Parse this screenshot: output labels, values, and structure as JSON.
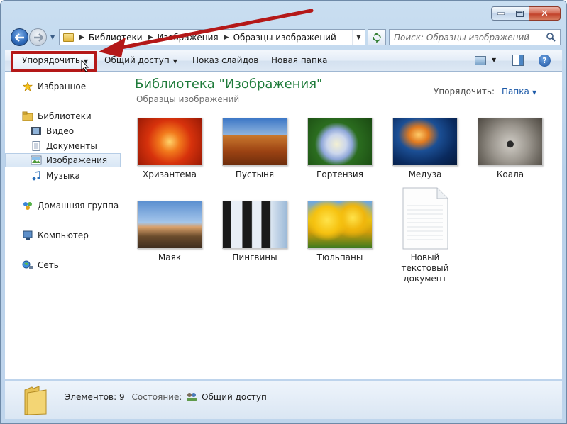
{
  "address": {
    "crumbs": [
      "Библиотеки",
      "Изображения",
      "Образцы изображений"
    ]
  },
  "search": {
    "placeholder": "Поиск: Образцы изображений"
  },
  "toolbar": {
    "organize": "Упорядочить",
    "share": "Общий доступ",
    "slideshow": "Показ слайдов",
    "new_folder": "Новая папка"
  },
  "sidebar": {
    "items": [
      {
        "label": "Избранное",
        "icon": "star-icon"
      },
      {
        "label": "Библиотеки",
        "icon": "libraries-icon"
      },
      {
        "label": "Видео",
        "icon": "video-icon"
      },
      {
        "label": "Документы",
        "icon": "documents-icon"
      },
      {
        "label": "Изображения",
        "icon": "pictures-icon"
      },
      {
        "label": "Музыка",
        "icon": "music-icon"
      },
      {
        "label": "Домашняя группа",
        "icon": "homegroup-icon"
      },
      {
        "label": "Компьютер",
        "icon": "computer-icon"
      },
      {
        "label": "Сеть",
        "icon": "network-icon"
      }
    ]
  },
  "library": {
    "title": "Библиотека \"Изображения\"",
    "subtitle": "Образцы изображений",
    "arrange_label": "Упорядочить:",
    "arrange_value": "Папка"
  },
  "files": [
    {
      "name": "Хризантема"
    },
    {
      "name": "Пустыня"
    },
    {
      "name": "Гортензия"
    },
    {
      "name": "Медуза"
    },
    {
      "name": "Коала"
    },
    {
      "name": "Маяк"
    },
    {
      "name": "Пингвины"
    },
    {
      "name": "Тюльпаны"
    },
    {
      "name": "Новый текстовый документ"
    }
  ],
  "status": {
    "items_label": "Элементов:",
    "items_count": "9",
    "state_label": "Состояние:",
    "state_value": "Общий доступ"
  },
  "colors": {
    "title_green": "#1e7b3a",
    "highlight_red": "#b41818",
    "link_blue": "#1d5aa8"
  }
}
